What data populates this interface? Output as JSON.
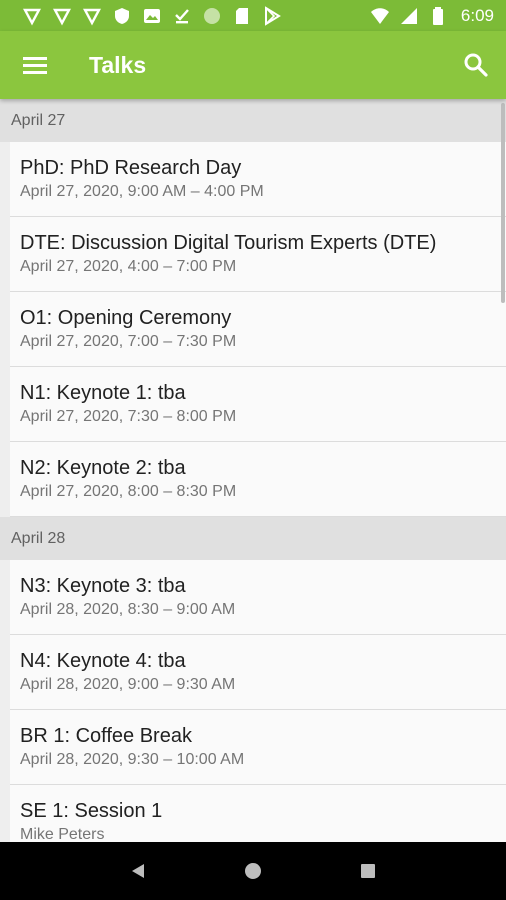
{
  "status_bar": {
    "time": "6:09",
    "icons": [
      "notification-icon",
      "notification-icon",
      "notification-icon",
      "shield-icon",
      "image-icon",
      "download-done-icon",
      "circle-icon",
      "sd-card-icon",
      "play-store-icon",
      "wifi-icon",
      "signal-icon",
      "battery-icon"
    ]
  },
  "app_bar": {
    "title": "Talks",
    "menu_icon": "hamburger-menu-icon",
    "search_icon": "search-icon",
    "color": "#8bc63e"
  },
  "sections": [
    {
      "date": "April 27",
      "talks": [
        {
          "title": "PhD: PhD Research Day",
          "subtitle": "April 27, 2020, 9:00 AM – 4:00 PM"
        },
        {
          "title": "DTE: Discussion Digital Tourism Experts (DTE)",
          "subtitle": "April 27, 2020, 4:00 – 7:00 PM"
        },
        {
          "title": "O1: Opening Ceremony",
          "subtitle": "April 27, 2020, 7:00 – 7:30 PM"
        },
        {
          "title": "N1: Keynote 1: tba",
          "subtitle": "April 27, 2020, 7:30 – 8:00 PM"
        },
        {
          "title": "N2: Keynote 2: tba",
          "subtitle": "April 27, 2020, 8:00 – 8:30 PM"
        }
      ]
    },
    {
      "date": "April 28",
      "talks": [
        {
          "title": "N3: Keynote 3: tba",
          "subtitle": "April 28, 2020, 8:30 – 9:00 AM"
        },
        {
          "title": "N4: Keynote 4: tba",
          "subtitle": "April 28, 2020, 9:00 – 9:30 AM"
        },
        {
          "title": "BR 1: Coffee Break",
          "subtitle": "April 28, 2020, 9:30 – 10:00 AM"
        },
        {
          "title": "SE 1: Session 1",
          "subtitle": "Mike Peters"
        }
      ]
    }
  ],
  "nav_bar": {
    "icons": [
      "back-icon",
      "home-icon",
      "recents-icon"
    ]
  }
}
